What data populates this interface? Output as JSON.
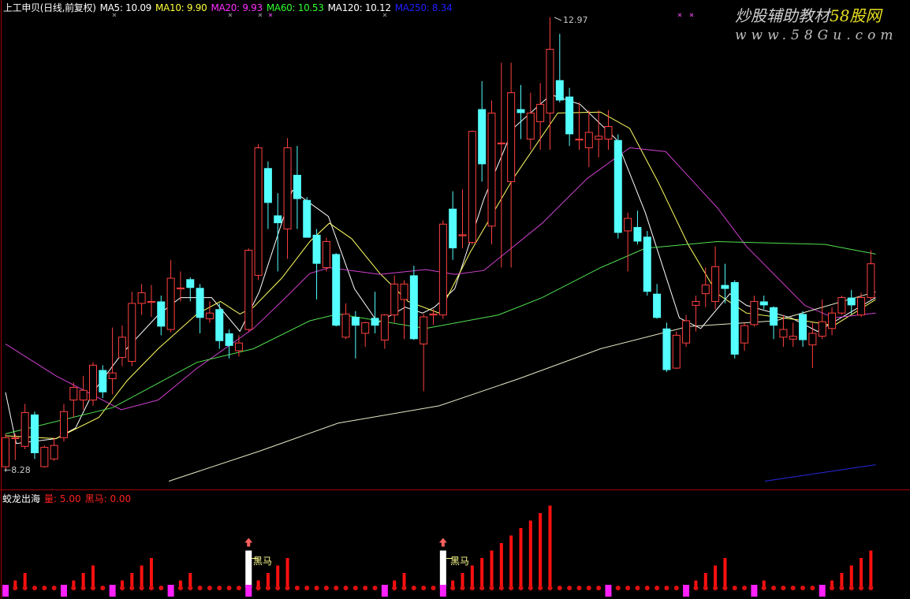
{
  "header": {
    "title": "上工申贝(日线,前复权)",
    "ma_labels": [
      {
        "text": "MA5: 10.09",
        "color": "#ffffff"
      },
      {
        "text": "MA10: 9.90",
        "color": "#ffff40"
      },
      {
        "text": "MA20: 9.93",
        "color": "#ff30ff"
      },
      {
        "text": "MA60: 10.53",
        "color": "#30ff30"
      },
      {
        "text": "MA120: 10.12",
        "color": "#ffffff"
      },
      {
        "text": "MA250: 8.34",
        "color": "#2020ff"
      }
    ]
  },
  "watermark": {
    "line1_a": "炒股辅助教材",
    "line1_b": "58股网",
    "line2": "www.58Gu.com"
  },
  "price_labels": {
    "high": "12.97",
    "low": "8.28"
  },
  "indicator": {
    "name": "蛟龙出海",
    "vol_label": "量: 5.00",
    "horse_label": "黑马: 0.00",
    "signal_text": "黑马"
  },
  "colors": {
    "up": "#ff4040",
    "down": "#54ffff",
    "grid": "#a00000",
    "vol": "#ff1010",
    "marker": "#ff20ff",
    "signal": "#ffffff"
  },
  "chart_data": [
    {
      "type": "candlestick",
      "title": "上工申贝(日线,前复权)",
      "ylim": [
        8.09,
        13.04
      ],
      "high_mark": 12.97,
      "low_mark": 8.28,
      "ohlc": [
        [
          8.32,
          8.66,
          8.3,
          8.62
        ],
        [
          8.61,
          8.66,
          8.39,
          8.62
        ],
        [
          8.53,
          8.97,
          8.5,
          8.88
        ],
        [
          8.86,
          8.89,
          8.4,
          8.46
        ],
        [
          8.32,
          8.54,
          8.31,
          8.52
        ],
        [
          8.4,
          8.62,
          8.38,
          8.54
        ],
        [
          8.62,
          8.97,
          8.58,
          8.89
        ],
        [
          9.01,
          9.19,
          8.83,
          9.14
        ],
        [
          9.01,
          9.26,
          8.91,
          9.11
        ],
        [
          9.01,
          9.4,
          8.95,
          9.37
        ],
        [
          9.32,
          9.37,
          9.03,
          9.09
        ],
        [
          9.23,
          9.76,
          9.07,
          9.29
        ],
        [
          9.45,
          9.78,
          9.36,
          9.66
        ],
        [
          9.41,
          10.13,
          9.36,
          10.01
        ],
        [
          10.01,
          10.21,
          9.89,
          10.12
        ],
        [
          10.02,
          10.2,
          9.87,
          10.03
        ],
        [
          10.03,
          10.09,
          9.68,
          9.77
        ],
        [
          9.74,
          10.46,
          9.71,
          10.27
        ],
        [
          10.16,
          10.34,
          10.03,
          10.17
        ],
        [
          10.26,
          10.28,
          10.03,
          10.17
        ],
        [
          10.17,
          10.21,
          9.7,
          9.86
        ],
        [
          9.85,
          10.03,
          9.81,
          9.91
        ],
        [
          9.95,
          10.01,
          9.54,
          9.62
        ],
        [
          9.7,
          9.74,
          9.44,
          9.57
        ],
        [
          9.52,
          9.68,
          9.46,
          9.6
        ],
        [
          9.74,
          10.58,
          9.72,
          10.56
        ],
        [
          10.3,
          11.66,
          10.25,
          11.62
        ],
        [
          11.41,
          11.48,
          10.78,
          11.05
        ],
        [
          10.92,
          11.15,
          10.34,
          10.84
        ],
        [
          10.78,
          11.72,
          10.47,
          11.62
        ],
        [
          11.34,
          11.64,
          10.78,
          11.09
        ],
        [
          11.08,
          11.11,
          10.69,
          10.69
        ],
        [
          10.72,
          10.78,
          10.05,
          10.42
        ],
        [
          10.38,
          10.69,
          10.34,
          10.65
        ],
        [
          10.52,
          10.53,
          9.77,
          9.78
        ],
        [
          9.66,
          10.01,
          9.64,
          9.9
        ],
        [
          9.87,
          9.93,
          9.44,
          9.78
        ],
        [
          9.7,
          9.82,
          9.56,
          9.81
        ],
        [
          9.86,
          10.13,
          9.7,
          9.78
        ],
        [
          9.63,
          9.9,
          9.54,
          9.89
        ],
        [
          9.89,
          10.3,
          9.81,
          10.21
        ],
        [
          10.05,
          10.25,
          9.64,
          10.21
        ],
        [
          10.3,
          10.4,
          9.63,
          9.64
        ],
        [
          9.59,
          9.9,
          9.1,
          9.87
        ],
        [
          9.89,
          9.95,
          9.79,
          9.9
        ],
        [
          9.89,
          10.87,
          9.85,
          10.83
        ],
        [
          10.99,
          11.17,
          10.46,
          10.58
        ],
        [
          10.71,
          11.19,
          10.58,
          10.72
        ],
        [
          10.64,
          11.8,
          10.62,
          11.79
        ],
        [
          12.02,
          12.31,
          11.27,
          11.45
        ],
        [
          10.81,
          12.11,
          10.62,
          11.98
        ],
        [
          11.66,
          12.5,
          10.38,
          11.67
        ],
        [
          11.27,
          12.5,
          10.38,
          12.19
        ],
        [
          12.02,
          12.27,
          11.71,
          11.98
        ],
        [
          11.71,
          12.19,
          11.6,
          11.98
        ],
        [
          11.89,
          12.29,
          11.6,
          12.07
        ],
        [
          11.98,
          12.97,
          11.6,
          12.64
        ],
        [
          12.32,
          12.8,
          12.09,
          12.11
        ],
        [
          12.15,
          12.24,
          11.64,
          11.76
        ],
        [
          11.7,
          12.09,
          11.6,
          11.71
        ],
        [
          11.62,
          12.01,
          11.42,
          11.78
        ],
        [
          11.71,
          12.01,
          11.52,
          11.74
        ],
        [
          11.71,
          12.01,
          11.6,
          11.84
        ],
        [
          11.7,
          11.76,
          10.68,
          10.74
        ],
        [
          10.76,
          10.95,
          10.34,
          10.89
        ],
        [
          10.8,
          10.97,
          10.62,
          10.65
        ],
        [
          10.7,
          10.76,
          10.09,
          10.13
        ],
        [
          10.11,
          10.21,
          9.85,
          9.86
        ],
        [
          9.75,
          9.81,
          9.3,
          9.32
        ],
        [
          9.34,
          9.72,
          9.33,
          9.68
        ],
        [
          9.6,
          9.89,
          9.56,
          9.83
        ],
        [
          9.99,
          10.09,
          9.72,
          10.03
        ],
        [
          10.11,
          10.38,
          9.97,
          10.2
        ],
        [
          10.03,
          10.6,
          9.95,
          10.39
        ],
        [
          10.2,
          10.42,
          10.01,
          10.16
        ],
        [
          10.23,
          10.25,
          9.44,
          9.48
        ],
        [
          9.6,
          9.81,
          9.52,
          9.78
        ],
        [
          9.79,
          10.09,
          9.77,
          10.03
        ],
        [
          10.03,
          10.09,
          9.95,
          9.99
        ],
        [
          9.97,
          9.98,
          9.64,
          9.78
        ],
        [
          9.66,
          9.89,
          9.56,
          9.74
        ],
        [
          9.64,
          9.81,
          9.56,
          9.67
        ],
        [
          9.9,
          9.93,
          9.56,
          9.63
        ],
        [
          9.58,
          9.81,
          9.34,
          9.7
        ],
        [
          9.67,
          10.05,
          9.64,
          9.82
        ],
        [
          9.75,
          9.97,
          9.68,
          9.91
        ],
        [
          9.91,
          10.09,
          9.89,
          10.07
        ],
        [
          10.07,
          10.15,
          9.9,
          9.99
        ],
        [
          9.89,
          10.12,
          9.87,
          10.07
        ],
        [
          10.07,
          10.56,
          10.05,
          10.42
        ]
      ],
      "series": [
        {
          "name": "MA5",
          "color": "#ffffff",
          "points": [
            [
              0,
              9.09
            ],
            [
              1.1,
              8.56
            ],
            [
              5.2,
              8.61
            ],
            [
              7.2,
              8.72
            ],
            [
              9.0,
              9.09
            ],
            [
              11.9,
              9.48
            ],
            [
              15.7,
              9.89
            ],
            [
              18.0,
              10.07
            ],
            [
              21.2,
              10.07
            ],
            [
              24.1,
              9.72
            ],
            [
              26.1,
              10.13
            ],
            [
              29.5,
              11.18
            ],
            [
              33.2,
              10.91
            ],
            [
              35.9,
              10.16
            ],
            [
              38.3,
              9.81
            ],
            [
              41.1,
              9.97
            ],
            [
              42.9,
              9.91
            ],
            [
              44.1,
              9.97
            ],
            [
              46.2,
              10.16
            ],
            [
              49.2,
              11.09
            ],
            [
              52.2,
              11.82
            ],
            [
              56.1,
              12.17
            ],
            [
              59.1,
              12.07
            ],
            [
              62.8,
              11.71
            ],
            [
              65.8,
              10.95
            ],
            [
              69.3,
              9.86
            ],
            [
              71.5,
              9.75
            ],
            [
              74.5,
              10.11
            ],
            [
              76.2,
              9.99
            ],
            [
              80.8,
              9.86
            ],
            [
              83.5,
              9.72
            ],
            [
              89.5,
              10.07
            ]
          ]
        },
        {
          "name": "MA10",
          "color": "#ffff60",
          "points": [
            [
              0,
              8.64
            ],
            [
              5.2,
              8.61
            ],
            [
              9.6,
              8.83
            ],
            [
              12.5,
              9.21
            ],
            [
              15.7,
              9.54
            ],
            [
              19.7,
              9.9
            ],
            [
              22.1,
              10.03
            ],
            [
              24.1,
              9.9
            ],
            [
              25.5,
              9.97
            ],
            [
              28.4,
              10.27
            ],
            [
              31.3,
              10.65
            ],
            [
              33.3,
              10.84
            ],
            [
              35.6,
              10.68
            ],
            [
              38.5,
              10.32
            ],
            [
              41.4,
              10.03
            ],
            [
              44.6,
              9.91
            ],
            [
              47.8,
              10.54
            ],
            [
              52.2,
              11.3
            ],
            [
              56.8,
              11.98
            ],
            [
              61.2,
              11.99
            ],
            [
              64.2,
              11.82
            ],
            [
              67.2,
              11.25
            ],
            [
              70.2,
              10.62
            ],
            [
              73.2,
              10.11
            ],
            [
              76.2,
              9.91
            ],
            [
              82.2,
              9.83
            ],
            [
              85.2,
              9.78
            ],
            [
              89.5,
              10.05
            ]
          ]
        },
        {
          "name": "MA20",
          "color": "#d040d0",
          "points": [
            [
              0,
              9.59
            ],
            [
              5.2,
              9.26
            ],
            [
              11.9,
              8.91
            ],
            [
              15.7,
              9.01
            ],
            [
              19.7,
              9.34
            ],
            [
              25.5,
              9.75
            ],
            [
              28.4,
              10.03
            ],
            [
              31.3,
              10.32
            ],
            [
              33.3,
              10.38
            ],
            [
              38.5,
              10.31
            ],
            [
              43.2,
              10.36
            ],
            [
              46.2,
              10.31
            ],
            [
              49.2,
              10.35
            ],
            [
              55.2,
              10.84
            ],
            [
              59.8,
              11.3
            ],
            [
              64.2,
              11.62
            ],
            [
              67.9,
              11.58
            ],
            [
              73.2,
              11.0
            ],
            [
              76.2,
              10.6
            ],
            [
              82.2,
              9.99
            ],
            [
              85.2,
              9.86
            ],
            [
              89.5,
              9.91
            ]
          ]
        },
        {
          "name": "MA60",
          "color": "#50e050",
          "points": [
            [
              0,
              8.66
            ],
            [
              11.0,
              8.93
            ],
            [
              19.7,
              9.4
            ],
            [
              25.5,
              9.54
            ],
            [
              31.3,
              9.83
            ],
            [
              34.2,
              9.9
            ],
            [
              43.2,
              9.75
            ],
            [
              50.7,
              9.89
            ],
            [
              55.2,
              10.07
            ],
            [
              61.2,
              10.38
            ],
            [
              65.8,
              10.58
            ],
            [
              73.2,
              10.65
            ],
            [
              84.3,
              10.62
            ],
            [
              89.5,
              10.52
            ]
          ]
        },
        {
          "name": "MA120",
          "color": "#e8e8c8",
          "points": [
            [
              16.8,
              8.17
            ],
            [
              26.1,
              8.48
            ],
            [
              34.2,
              8.77
            ],
            [
              44.6,
              8.95
            ],
            [
              52.8,
              9.23
            ],
            [
              61.2,
              9.54
            ],
            [
              70.2,
              9.77
            ],
            [
              79.2,
              9.83
            ],
            [
              89.5,
              10.13
            ]
          ]
        },
        {
          "name": "MA250",
          "color": "#2828e0",
          "points": [
            [
              78.1,
              8.17
            ],
            [
              89.5,
              8.34
            ]
          ]
        }
      ]
    },
    {
      "type": "bar",
      "title": "蛟龙出海",
      "ylim": [
        0,
        12
      ],
      "values": [
        0,
        1,
        2,
        0,
        0,
        0,
        0,
        1,
        2,
        3,
        0,
        0,
        1,
        2,
        3,
        4,
        0,
        0,
        1,
        2,
        0,
        0,
        0,
        0,
        0,
        5,
        1,
        2,
        3,
        4,
        0,
        0,
        0,
        0,
        0,
        0,
        0,
        0,
        0,
        0,
        1,
        2,
        0,
        0,
        0,
        5,
        1,
        2,
        3,
        4,
        5,
        6,
        7,
        8,
        9,
        10,
        11,
        0,
        0,
        0,
        0,
        0,
        0,
        0,
        0,
        0,
        0,
        0,
        0,
        0,
        0,
        1,
        2,
        3,
        4,
        0,
        0,
        0,
        1,
        0,
        0,
        0,
        0,
        0,
        0,
        1,
        2,
        3,
        4,
        5
      ],
      "markers": [
        0,
        6,
        11,
        17,
        25,
        39,
        45,
        62,
        70,
        77,
        84
      ],
      "signals": [
        25,
        45
      ]
    }
  ]
}
